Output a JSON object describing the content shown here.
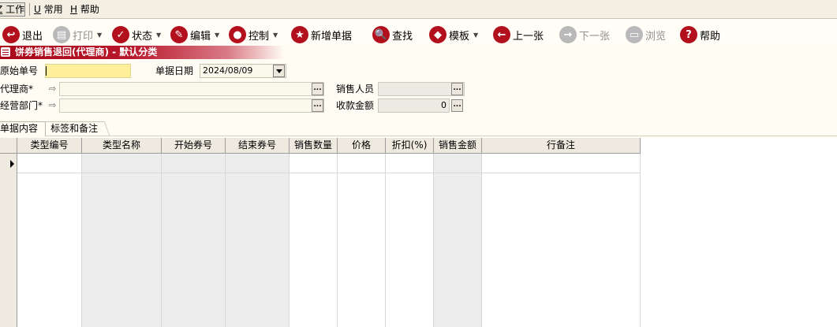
{
  "menu": {
    "items": [
      {
        "key": "Z",
        "label": "工作"
      },
      {
        "key": "U",
        "label": "常用"
      },
      {
        "key": "H",
        "label": "帮助"
      }
    ]
  },
  "toolbar": {
    "items": [
      {
        "label": "退出",
        "glyph": "↩",
        "disabled": false,
        "dropdown": false
      },
      {
        "label": "打印",
        "glyph": "▤",
        "disabled": true,
        "dropdown": true
      },
      {
        "label": "状态",
        "glyph": "✓",
        "disabled": false,
        "dropdown": true
      },
      {
        "label": "编辑",
        "glyph": "✎",
        "disabled": false,
        "dropdown": true
      },
      {
        "label": "控制",
        "glyph": "●",
        "disabled": false,
        "dropdown": true
      },
      {
        "label": "新增单据",
        "glyph": "★",
        "disabled": false,
        "dropdown": false
      },
      {
        "label": "查找",
        "glyph": "🔍",
        "disabled": false,
        "dropdown": false
      },
      {
        "label": "模板",
        "glyph": "◆",
        "disabled": false,
        "dropdown": true
      },
      {
        "label": "上一张",
        "glyph": "←",
        "disabled": false,
        "dropdown": false
      },
      {
        "label": "下一张",
        "glyph": "→",
        "disabled": true,
        "dropdown": false
      },
      {
        "label": "浏览",
        "glyph": "▭",
        "disabled": true,
        "dropdown": false
      },
      {
        "label": "帮助",
        "glyph": "?",
        "disabled": false,
        "dropdown": false
      }
    ]
  },
  "window": {
    "title": "饼券销售退回(代理商) - 默认分类"
  },
  "form": {
    "orig_no_label": "原始单号",
    "orig_no_value": "",
    "date_label": "单据日期",
    "date_value": "2024/08/09",
    "agent_label": "代理商*",
    "agent_value": "",
    "sales_person_label": "销售人员",
    "sales_person_value": "",
    "dept_label": "经营部门*",
    "dept_value": "",
    "amount_label": "收款金额",
    "amount_value": "0",
    "ellipsis": "..."
  },
  "tabs": {
    "items": [
      "单据内容",
      "标签和备注"
    ]
  },
  "table": {
    "columns": [
      "类型编号",
      "类型名称",
      "开始券号",
      "结束券号",
      "销售数量",
      "价格",
      "折扣(%)",
      "销售金额",
      "行备注"
    ],
    "rows": []
  }
}
